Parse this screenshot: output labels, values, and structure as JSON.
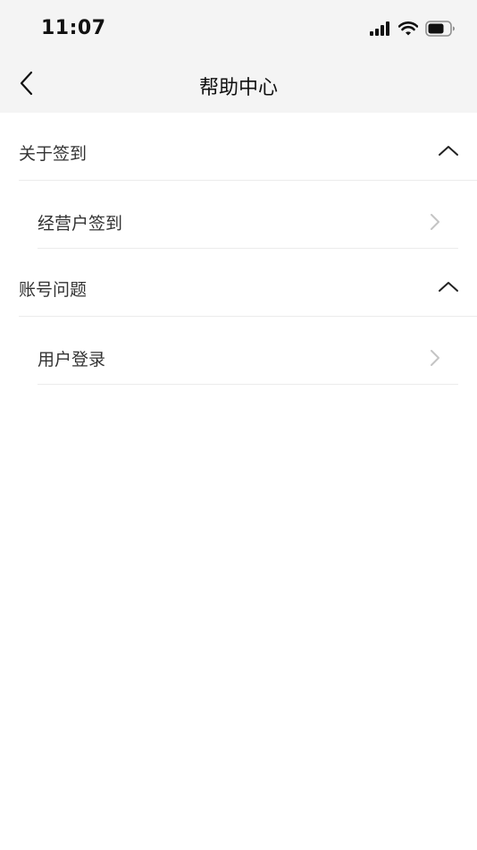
{
  "status_bar": {
    "time": "11:07",
    "icons": [
      "cellular-signal-icon",
      "wifi-icon",
      "battery-icon"
    ]
  },
  "nav": {
    "title": "帮助中心",
    "back_icon": "chevron-left-icon"
  },
  "sections": [
    {
      "title": "关于签到",
      "expanded": true,
      "toggle_icon": "chevron-up-icon",
      "items": [
        {
          "label": "经营户签到",
          "icon": "chevron-right-icon"
        }
      ]
    },
    {
      "title": "账号问题",
      "expanded": true,
      "toggle_icon": "chevron-up-icon",
      "items": [
        {
          "label": "用户登录",
          "icon": "chevron-right-icon"
        }
      ]
    }
  ],
  "colors": {
    "header_background": "#f4f4f4",
    "page_background": "#ffffff",
    "text": "#333333",
    "divider": "#ececec",
    "arrow": "#c4c4c4"
  }
}
